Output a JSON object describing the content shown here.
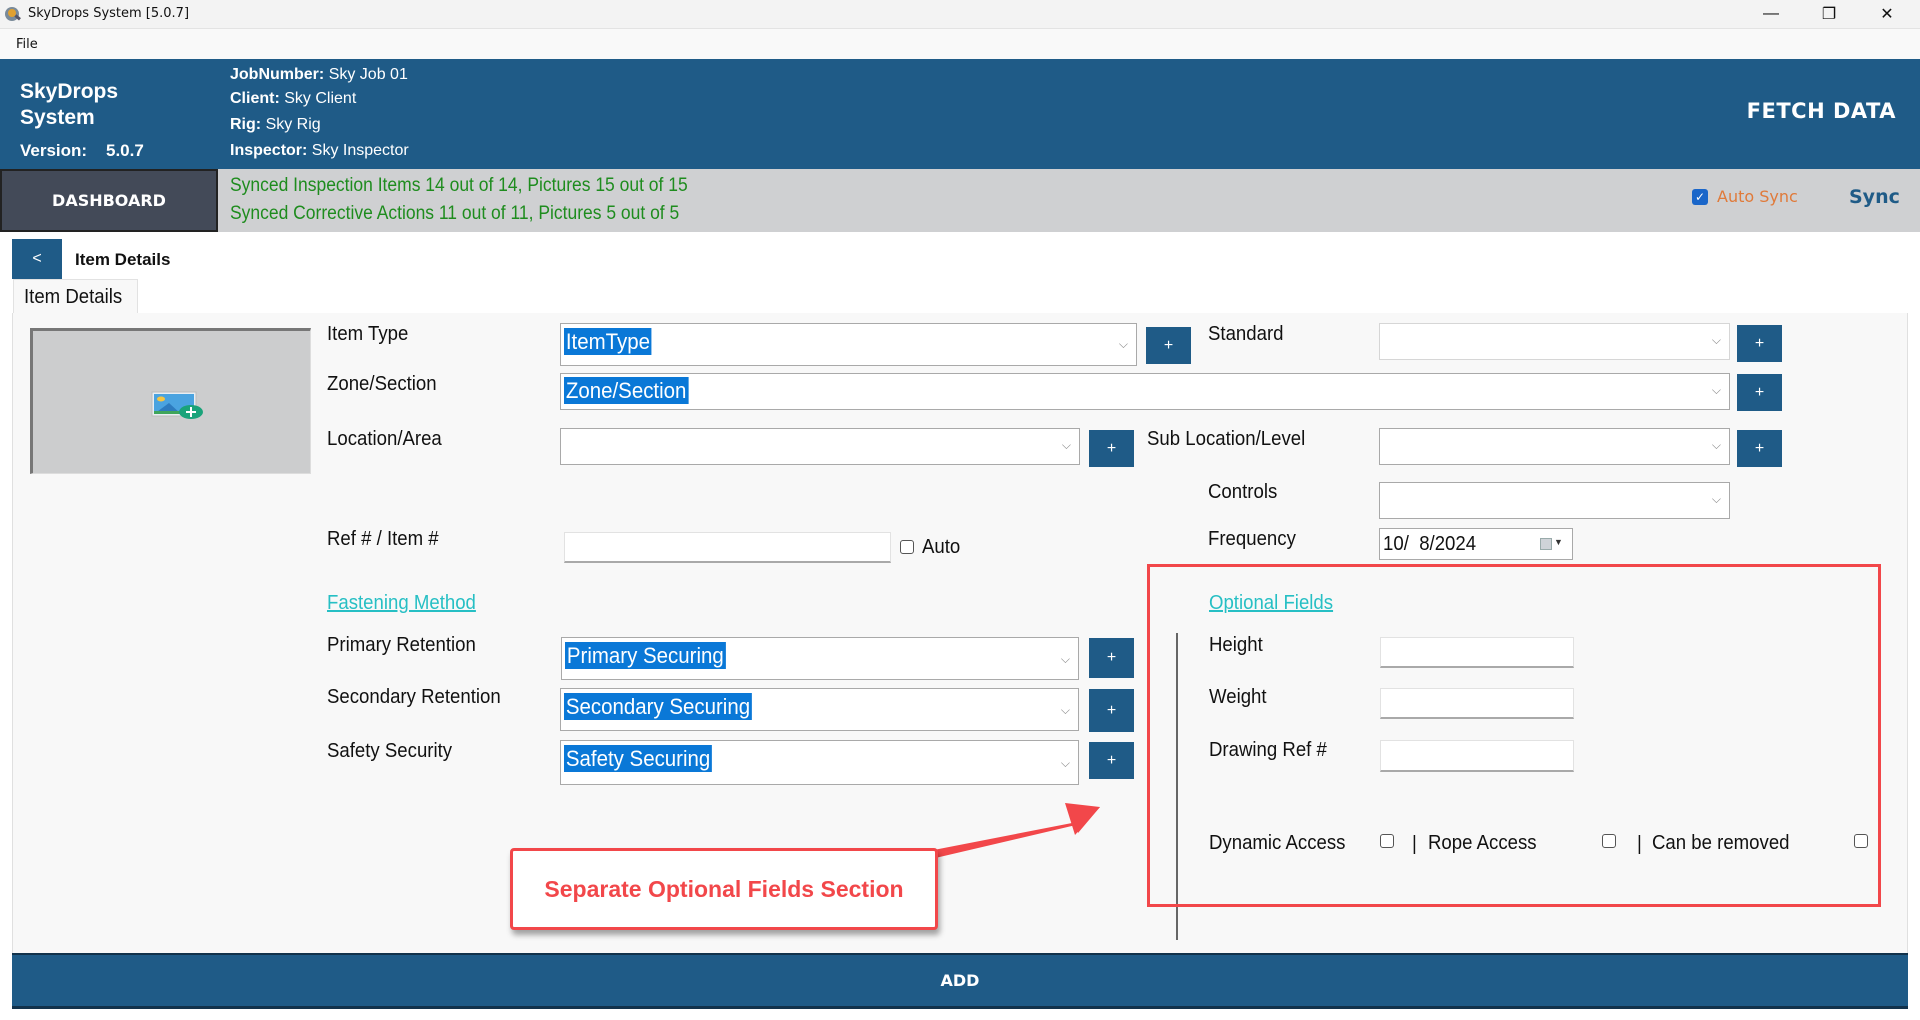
{
  "window": {
    "title": "SkyDrops System [5.0.7]",
    "minimize": "—",
    "restore": "❐",
    "close": "✕"
  },
  "menu": {
    "file": "File"
  },
  "header": {
    "brand_line1": "SkyDrops",
    "brand_line2": "System",
    "version_label": "Version:",
    "version_value": "5.0.7",
    "job_label": "JobNumber:",
    "job_value": "Sky Job 01",
    "client_label": "Client:",
    "client_value": "Sky Client",
    "rig_label": "Rig:",
    "rig_value": "Sky Rig",
    "inspector_label": "Inspector:",
    "inspector_value": "Sky Inspector",
    "fetch_data": "FETCH DATA"
  },
  "syncbar": {
    "dashboard": "DASHBOARD",
    "line1": "Synced Inspection Items 14 out of 14, Pictures 15 out of 15",
    "line2": "Synced Corrective Actions 11 out of 11, Pictures 5 out of 5",
    "auto_sync_label": "Auto Sync",
    "auto_sync_checked": true,
    "sync": "Sync"
  },
  "page": {
    "back": "<",
    "title": "Item Details",
    "tab": "Item Details"
  },
  "form": {
    "item_type_label": "Item Type",
    "item_type_value": "ItemType",
    "standard_label": "Standard",
    "standard_value": "",
    "zone_label": "Zone/Section",
    "zone_value": "Zone/Section",
    "location_label": "Location/Area",
    "location_value": "",
    "sub_location_label": "Sub Location/Level",
    "sub_location_value": "",
    "controls_label": "Controls",
    "controls_value": "",
    "ref_label": "Ref # / Item #",
    "ref_value": "",
    "auto_label": "Auto",
    "auto_checked": false,
    "frequency_label": "Frequency",
    "frequency_value": "10/  8/2024",
    "fastening_heading": "Fastening Method",
    "primary_label": "Primary Retention",
    "primary_value": "Primary Securing",
    "secondary_label": "Secondary Retention",
    "secondary_value": "Secondary Securing",
    "safety_label": "Safety Security",
    "safety_value": "Safety Securing",
    "plus": "+",
    "chevron": "⌵"
  },
  "optional": {
    "heading": "Optional Fields",
    "height_label": "Height",
    "height_value": "",
    "weight_label": "Weight",
    "weight_value": "",
    "drawing_label": "Drawing Ref #",
    "drawing_value": "",
    "dynamic_access": "Dynamic Access",
    "rope_access": "Rope Access",
    "can_be_removed": "Can be removed",
    "separator": "|"
  },
  "annotation": {
    "callout": "Separate Optional Fields Section",
    "color": "#f2474a"
  },
  "footer": {
    "add": "ADD"
  },
  "colors": {
    "primary": "#1f5b87",
    "sync_green": "#1e8c1e",
    "link_teal": "#26bfc4",
    "auto_sync_orange": "#e07a3a"
  }
}
